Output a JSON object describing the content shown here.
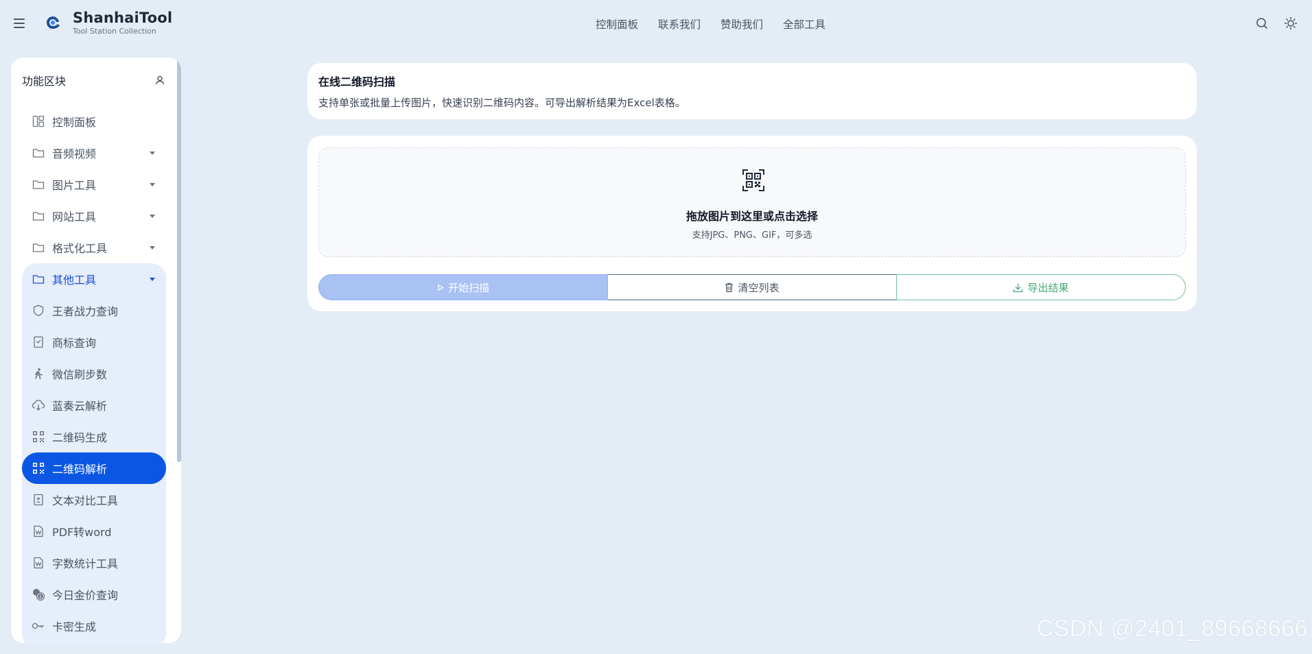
{
  "header": {
    "brand_name": "ShanhaiTool",
    "brand_sub": "Tool Station Collection",
    "nav": [
      "控制面板",
      "联系我们",
      "赞助我们",
      "全部工具"
    ]
  },
  "sidebar": {
    "title": "功能区块",
    "items": [
      {
        "label": "控制面板",
        "icon": "dashboard-icon"
      },
      {
        "label": "音频视频",
        "icon": "folder-icon"
      },
      {
        "label": "图片工具",
        "icon": "folder-icon"
      },
      {
        "label": "网站工具",
        "icon": "folder-icon"
      },
      {
        "label": "格式化工具",
        "icon": "folder-icon"
      }
    ],
    "group": {
      "label": "其他工具",
      "children": [
        {
          "label": "王者战力查询",
          "icon": "shield-icon"
        },
        {
          "label": "商标查询",
          "icon": "bookmark-icon"
        },
        {
          "label": "微信刷步数",
          "icon": "walk-icon"
        },
        {
          "label": "蓝奏云解析",
          "icon": "cloud-download-icon"
        },
        {
          "label": "二维码生成",
          "icon": "qrcode-icon"
        },
        {
          "label": "二维码解析",
          "icon": "qrcode-icon",
          "active": true
        },
        {
          "label": "文本对比工具",
          "icon": "file-diff-icon"
        },
        {
          "label": "PDF转word",
          "icon": "word-file-icon"
        },
        {
          "label": "字数统计工具",
          "icon": "word-file-icon"
        },
        {
          "label": "今日金价查询",
          "icon": "coins-icon"
        },
        {
          "label": "卡密生成",
          "icon": "key-icon"
        }
      ]
    }
  },
  "main": {
    "title": "在线二维码扫描",
    "description": "支持单张或批量上传图片，快速识别二维码内容。可导出解析结果为Excel表格。",
    "dropzone": {
      "title": "拖放图片到这里或点击选择",
      "subtitle": "支持JPG、PNG、GIF，可多选"
    },
    "buttons": {
      "scan": "开始扫描",
      "clear": "清空列表",
      "export": "导出结果"
    }
  },
  "watermark": "CSDN @2401_89668666",
  "colors": {
    "background": "#e4ecf5",
    "accent": "#0b57e3",
    "scan_button": "#a9c1f3",
    "export_green": "#4aa87a"
  }
}
